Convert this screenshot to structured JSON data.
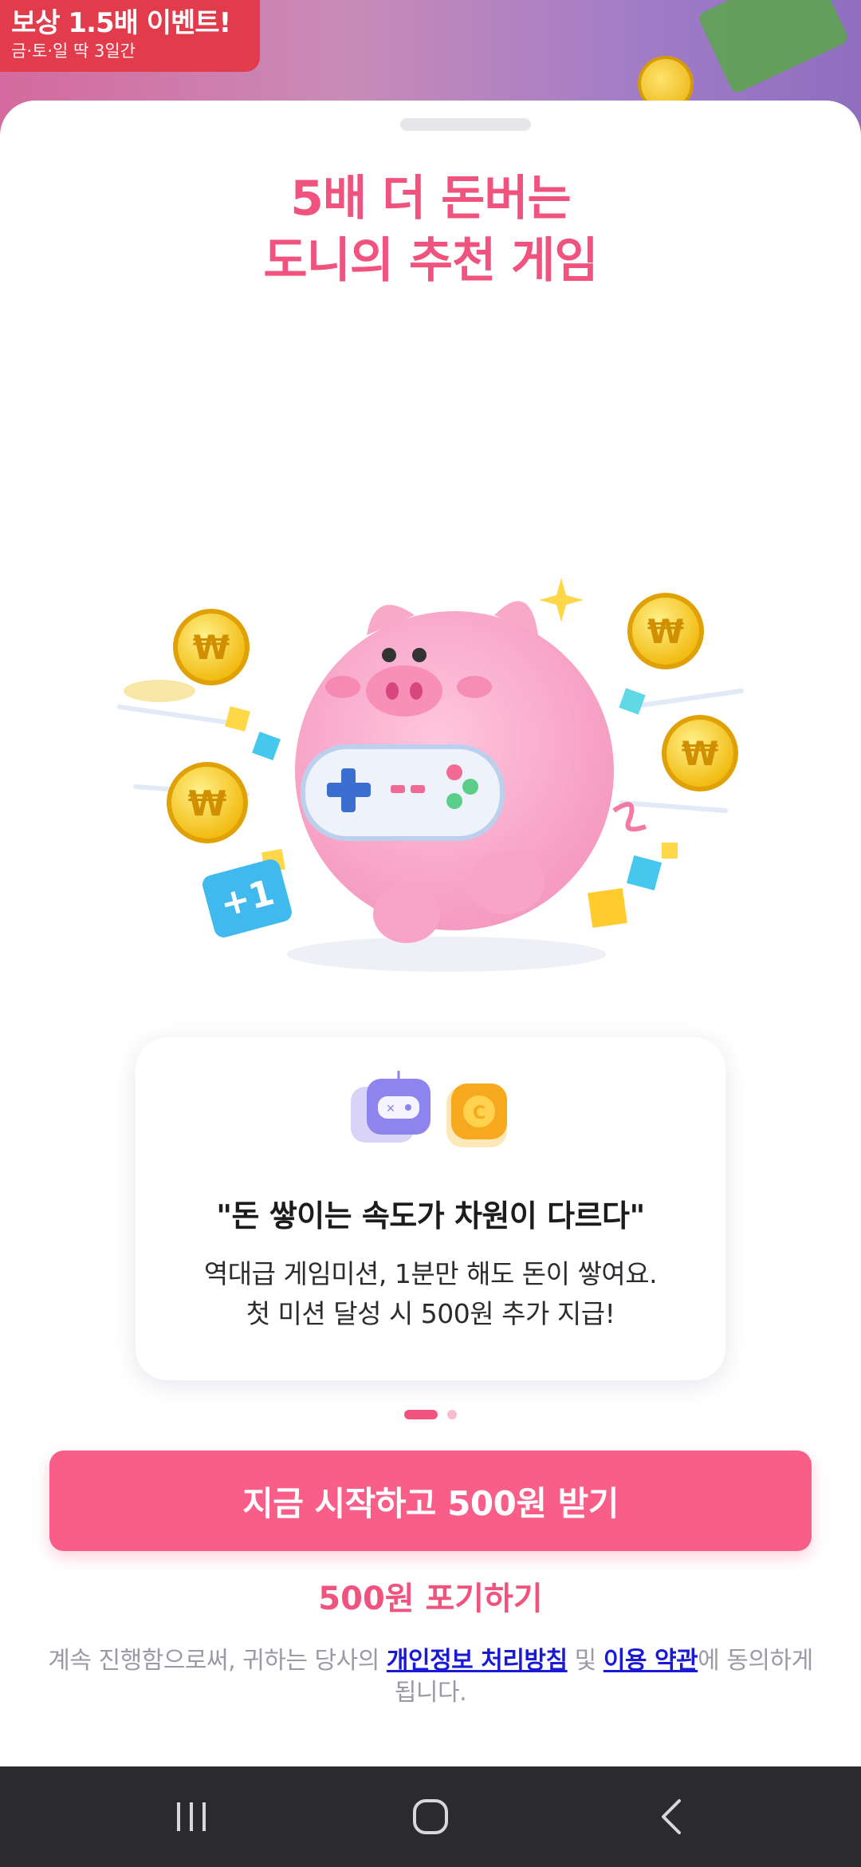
{
  "background": {
    "event_title": "보상 1.5배 이벤트!",
    "event_subtitle": "금·토·일 딱 3일간"
  },
  "sheet": {
    "title_line1": "5배 더 돈버는",
    "title_line2": "도니의 추천 게임"
  },
  "card": {
    "quote": "\"돈 쌓이는 속도가 차원이 다르다\"",
    "desc_line1": "역대급 게임미션, 1분만 해도 돈이 쌓여요.",
    "desc_line2": "첫 미션 달성 시 500원 추가 지급!",
    "icons": [
      "gamepad-icon",
      "coin-icon"
    ]
  },
  "pager": {
    "total": 2,
    "active": 0
  },
  "cta": {
    "label": "지금 시작하고 500원 받기"
  },
  "giveup": {
    "label": "500원 포기하기"
  },
  "legal": {
    "prefix": "계속 진행함으로써, 귀하는 당사의 ",
    "privacy_link": "개인정보 처리방침",
    "middle": " 및 ",
    "terms_link": "이용 약관",
    "suffix": "에 동의하게 됩니다."
  },
  "colors": {
    "accent": "#f0547e",
    "cta_bg": "#f85e88",
    "link": "#1a1ad6",
    "navbar": "#2b2b2e"
  },
  "navbar": {
    "icons": [
      "recent-apps-icon",
      "home-icon",
      "back-icon"
    ]
  }
}
